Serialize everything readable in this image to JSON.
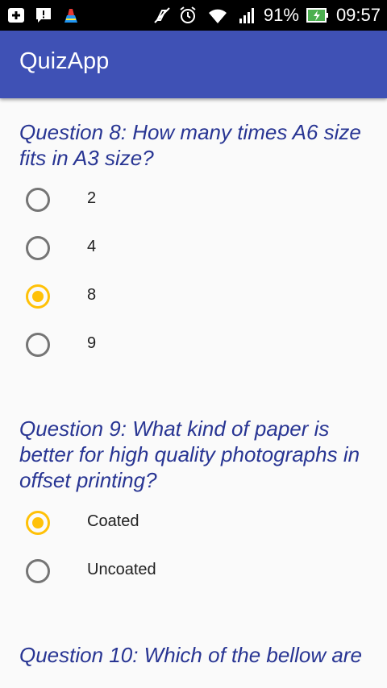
{
  "status_bar": {
    "battery": "91%",
    "time": "09:57",
    "icons": [
      "add-box-icon",
      "alert-icon",
      "cleaner-icon",
      "mute-icon",
      "alarm-icon",
      "wifi-icon",
      "signal-icon",
      "battery-charging-icon"
    ]
  },
  "app_bar": {
    "title": "QuizApp",
    "color": "#3f51b5"
  },
  "colors": {
    "question_text": "#283593",
    "radio_checked": "#ffc107",
    "radio_unchecked": "#757575"
  },
  "questions": [
    {
      "text": "Question 8: How many times A6 size fits in A3 size?",
      "options": [
        {
          "label": "2",
          "checked": false
        },
        {
          "label": "4",
          "checked": false
        },
        {
          "label": "8",
          "checked": true
        },
        {
          "label": "9",
          "checked": false
        }
      ]
    },
    {
      "text": "Question 9: What kind of paper is better for high quality photographs in offset printing?",
      "options": [
        {
          "label": "Coated",
          "checked": true
        },
        {
          "label": "Uncoated",
          "checked": false
        }
      ]
    },
    {
      "text": "Question 10: Which of the bellow are",
      "options": []
    }
  ]
}
